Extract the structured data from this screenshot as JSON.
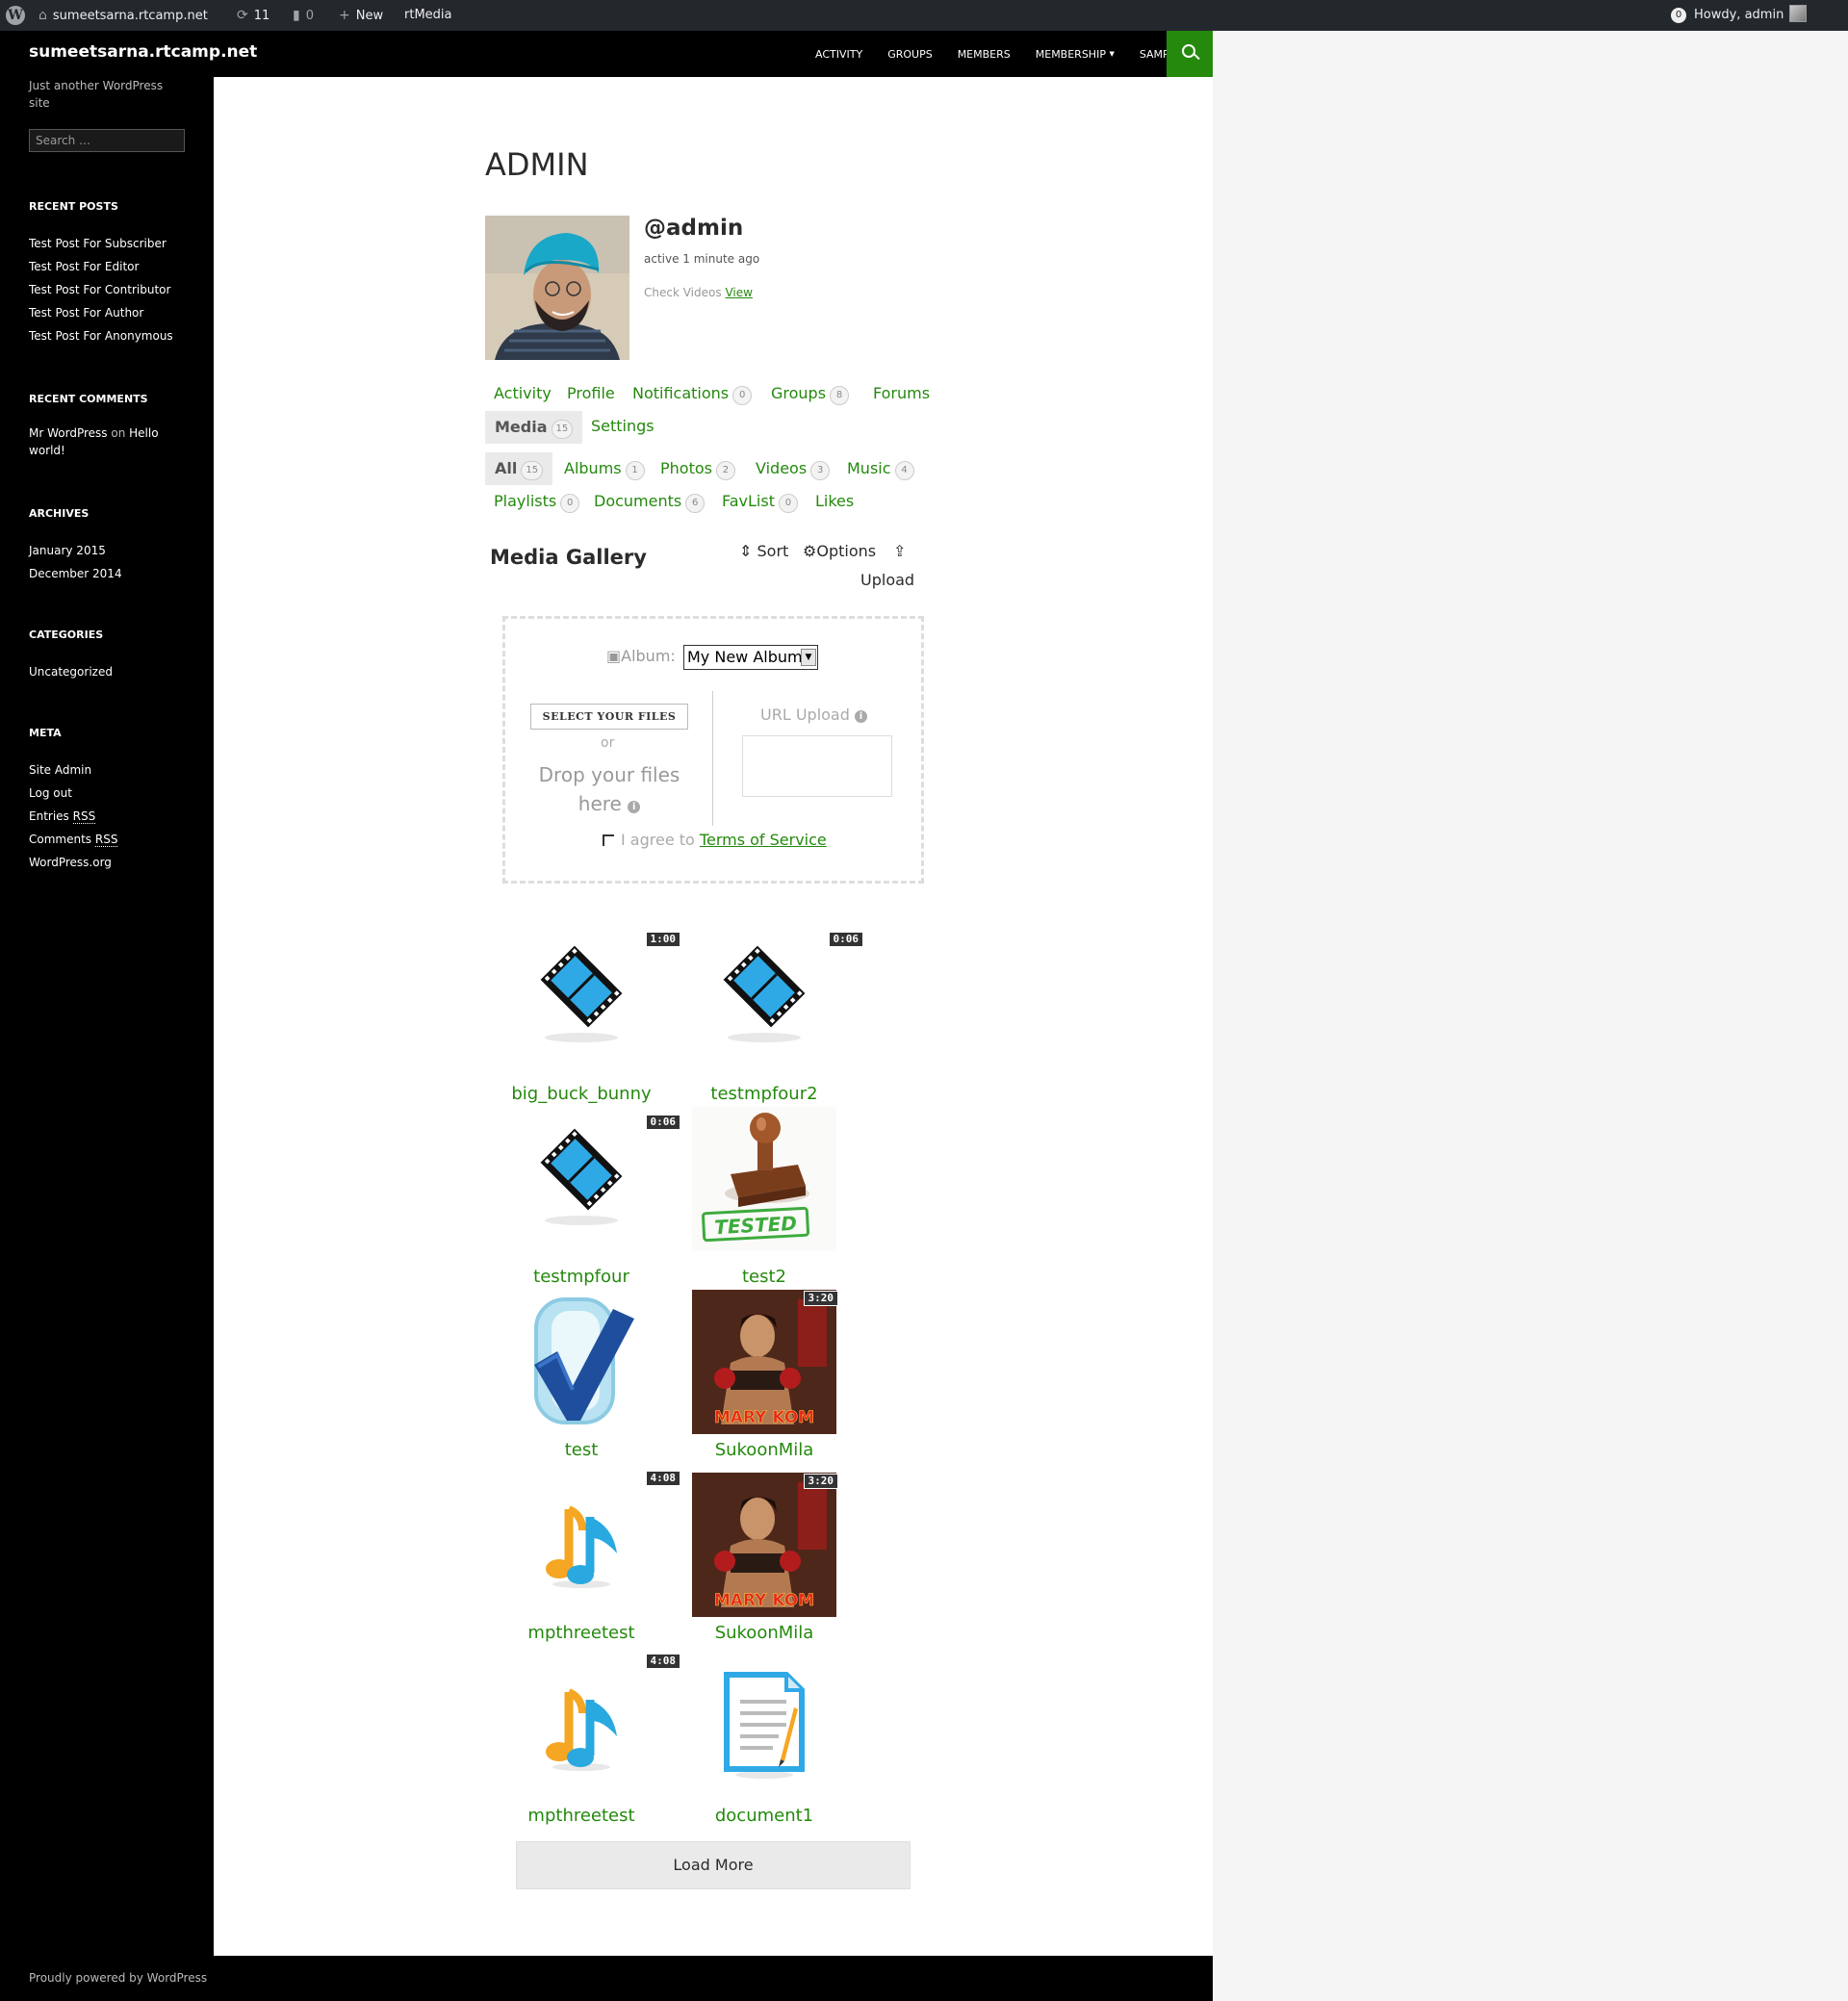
{
  "adminbar": {
    "site": "sumeetsarna.rtcamp.net",
    "updates": "11",
    "comments": "0",
    "new": "New",
    "rtmedia": "rtMedia",
    "notifications": "0",
    "howdy": "Howdy, admin"
  },
  "site": {
    "title": "sumeetsarna.rtcamp.net",
    "description": "Just another WordPress site",
    "search_placeholder": "Search …"
  },
  "nav": [
    "ACTIVITY",
    "GROUPS",
    "MEMBERS",
    "MEMBERSHIP",
    "SAMPLE PAGE"
  ],
  "sidebar": {
    "recent_posts": {
      "title": "RECENT POSTS",
      "items": [
        "Test Post For Subscriber",
        "Test Post For Editor",
        "Test Post For Contributor",
        "Test Post For Author",
        "Test Post For Anonymous"
      ]
    },
    "recent_comments": {
      "title": "RECENT COMMENTS",
      "author": "Mr WordPress",
      "on": "on",
      "post": "Hello world!"
    },
    "archives": {
      "title": "ARCHIVES",
      "items": [
        "January 2015",
        "December 2014"
      ]
    },
    "categories": {
      "title": "CATEGORIES",
      "items": [
        "Uncategorized"
      ]
    },
    "meta": {
      "title": "META",
      "items": [
        "Site Admin",
        "Log out",
        "Entries",
        "Comments",
        "WordPress.org"
      ],
      "rss": "RSS"
    }
  },
  "profile": {
    "name": "ADMIN",
    "username": "@admin",
    "activity": "active 1 minute ago",
    "check_videos": "Check Videos",
    "view": "View"
  },
  "profile_tabs": [
    {
      "label": "Activity"
    },
    {
      "label": "Profile"
    },
    {
      "label": "Notifications",
      "count": "0"
    },
    {
      "label": "Groups",
      "count": "8"
    },
    {
      "label": "Forums"
    },
    {
      "label": "Media",
      "count": "15"
    },
    {
      "label": "Settings"
    }
  ],
  "media_tabs": [
    {
      "label": "All",
      "count": "15"
    },
    {
      "label": "Albums",
      "count": "1"
    },
    {
      "label": "Photos",
      "count": "2"
    },
    {
      "label": "Videos",
      "count": "3"
    },
    {
      "label": "Music",
      "count": "4"
    },
    {
      "label": "Playlists",
      "count": "0"
    },
    {
      "label": "Documents",
      "count": "6"
    },
    {
      "label": "FavList",
      "count": "0"
    },
    {
      "label": "Likes"
    }
  ],
  "gallery": {
    "title": "Media Gallery",
    "sort": "Sort",
    "options": "Options",
    "upload": "Upload"
  },
  "uploader": {
    "album_label": "Album:",
    "album_value": "My New Album",
    "select_files": "Select your files",
    "or": "or",
    "drop_text": "Drop your files here",
    "url_upload": "URL Upload",
    "agree": "I agree to",
    "terms": "Terms of Service"
  },
  "media_items": [
    {
      "title": "big_buck_bunny",
      "type": "video",
      "duration": "1:00"
    },
    {
      "title": "testmpfour2",
      "type": "video",
      "duration": "0:06"
    },
    {
      "title": "testmpfour",
      "type": "video",
      "duration": "0:06"
    },
    {
      "title": "test2",
      "type": "stamp-image"
    },
    {
      "title": "test",
      "type": "checkmark-image"
    },
    {
      "title": "SukoonMila",
      "type": "poster",
      "duration": "3:20",
      "poster_text": "MARY KOM"
    },
    {
      "title": "mpthreetest",
      "type": "music",
      "duration": "4:08"
    },
    {
      "title": "SukoonMila",
      "type": "poster",
      "duration": "3:20",
      "poster_text": "MARY KOM"
    },
    {
      "title": "mpthreetest",
      "type": "music",
      "duration": "4:08"
    },
    {
      "title": "document1",
      "type": "document"
    }
  ],
  "stamp_text": "TESTED",
  "load_more": "Load More",
  "footer": "Proudly powered by WordPress"
}
